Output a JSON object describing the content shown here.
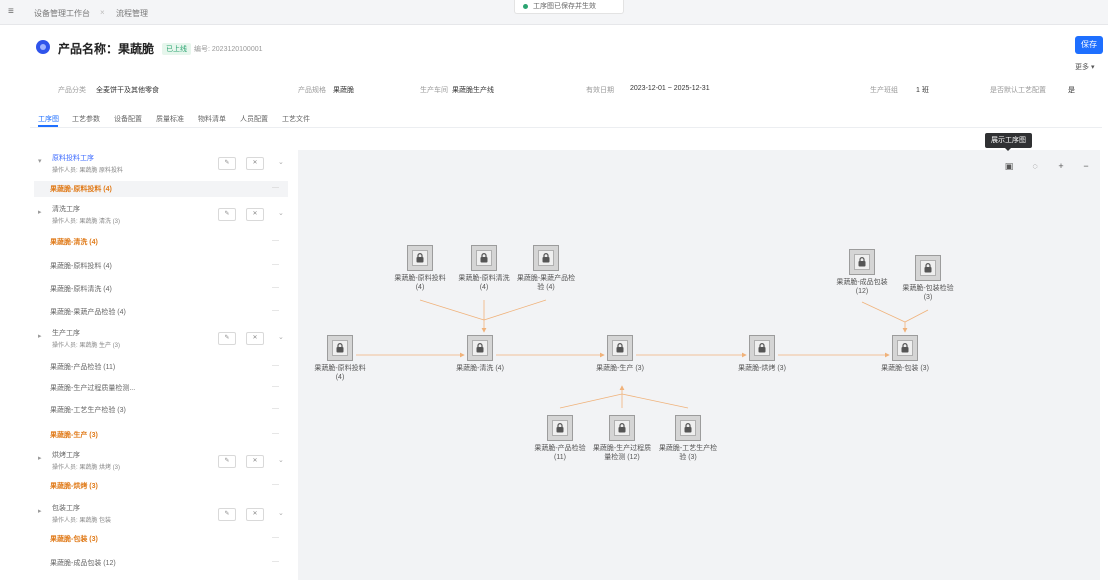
{
  "topbar": {
    "menu_icon": "menu-icon",
    "tab_label": "设备管理工作台",
    "tab2_label": "流程管理",
    "status_text": "工序图已保存并生效",
    "status_color": "#2ba471"
  },
  "header": {
    "icon": "product-icon",
    "title": "产品名称：果蔬脆",
    "badge": "已上线",
    "code": "编号: 2023120100001",
    "save_label": "保存",
    "more_label": "更多 ▾"
  },
  "info": [
    {
      "label": "产品分类",
      "value": "全麦饼干及其他零食"
    },
    {
      "label": "产品规格",
      "value": "果蔬脆"
    },
    {
      "label": "生产车间",
      "value": "果蔬脆生产线"
    },
    {
      "label": "有效日期",
      "value": "2023-12-01 ~ 2025-12-31"
    },
    {
      "label": "生产班组",
      "value": "1 班"
    },
    {
      "label": "是否默认工艺配置",
      "value": "是"
    }
  ],
  "tabs": [
    "工序图",
    "工艺参数",
    "设备配置",
    "质量标准",
    "物料清单",
    "人员配置",
    "工艺文件"
  ],
  "sidebar": {
    "rows": [
      {
        "type": "group",
        "title": "原料投料工序",
        "sub": "操作人员: 果蔬脆 原料投料"
      },
      {
        "type": "item",
        "label": "果蔬脆-原料投料 (4)",
        "tone": "orange"
      },
      {
        "type": "group",
        "title": "清洗工序",
        "sub": "操作人员: 果蔬脆 清洗 (3)"
      },
      {
        "type": "item",
        "label": "果蔬脆-清洗 (4)",
        "tone": "orange"
      },
      {
        "type": "item",
        "label": "果蔬脆-原料投料 (4)",
        "tone": "gray"
      },
      {
        "type": "item",
        "label": "果蔬脆-原料清洗 (4)",
        "tone": "gray"
      },
      {
        "type": "item",
        "label": "果蔬脆-果蔬产品检验 (4)",
        "tone": "gray"
      },
      {
        "type": "group",
        "title": "生产工序",
        "sub": "操作人员: 果蔬脆 生产 (3)"
      },
      {
        "type": "item",
        "label": "果蔬脆-产品检验 (11)",
        "tone": "gray"
      },
      {
        "type": "item",
        "label": "果蔬脆-生产过程质量检测...",
        "tone": "gray"
      },
      {
        "type": "item",
        "label": "果蔬脆-工艺生产检验 (3)",
        "tone": "gray"
      },
      {
        "type": "item",
        "label": "果蔬脆-生产 (3)",
        "tone": "orange"
      },
      {
        "type": "group",
        "title": "烘烤工序",
        "sub": "操作人员: 果蔬脆 烘烤 (3)"
      },
      {
        "type": "item",
        "label": "果蔬脆-烘烤 (3)",
        "tone": "orange"
      },
      {
        "type": "group",
        "title": "包装工序",
        "sub": "操作人员: 果蔬脆 包装"
      },
      {
        "type": "item",
        "label": "果蔬脆-包装 (3)",
        "tone": "orange"
      },
      {
        "type": "item",
        "label": "果蔬脆-成品包装 (12)",
        "tone": "gray"
      }
    ],
    "dash": "—",
    "edit_icon": "edit-icon",
    "delete_icon": "delete-icon"
  },
  "canvas": {
    "tooltip": "展示工序图",
    "tools": [
      "fit-view-icon",
      "reset-icon",
      "zoom-in-icon",
      "zoom-out-icon"
    ],
    "edge_color": "#f0b27a",
    "nodes": [
      "果蔬脆-原料投料 (4)",
      "果蔬脆-清洗 (4)",
      "果蔬脆-生产 (3)",
      "果蔬脆-烘烤 (3)",
      "果蔬脆-包装 (3)",
      "果蔬脆-原料投料 (4)",
      "果蔬脆-原料清洗 (4)",
      "果蔬脆-果蔬产品检验 (4)",
      "果蔬脆-产品检验 (11)",
      "果蔬脆-生产过程质量检测 (12)",
      "果蔬脆-工艺生产检验 (3)",
      "果蔬脆-成品包装 (12)",
      "果蔬脆-包装检验 (3)"
    ]
  }
}
